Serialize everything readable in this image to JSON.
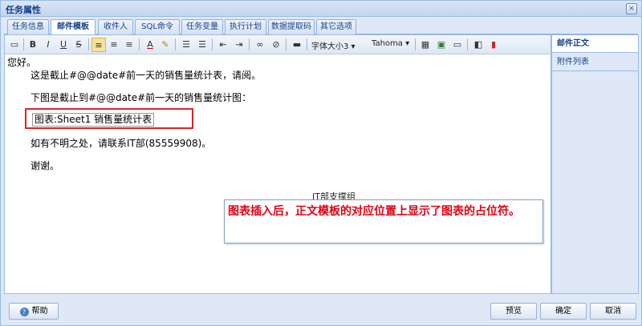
{
  "window": {
    "title": "任务属性",
    "close_glyph": "×"
  },
  "tabs": [
    {
      "label": "任务信息"
    },
    {
      "label": "邮件模板"
    },
    {
      "label": "收件人"
    },
    {
      "label": "SQL命令"
    },
    {
      "label": "任务变量"
    },
    {
      "label": "执行计划"
    },
    {
      "label": "数据提取码"
    },
    {
      "label": "其它选项"
    }
  ],
  "toolbar": {
    "bold": "B",
    "italic": "I",
    "underline": "U",
    "strike": "S",
    "font_color": "A",
    "font_size": "字体大小3",
    "font_name": "Tahoma",
    "icons": [
      "source-edit-icon",
      "bold-icon",
      "italic-icon",
      "underline-icon",
      "strikethrough-icon",
      "align-left-icon",
      "align-center-icon",
      "align-right-icon",
      "font-color-icon",
      "highlight-icon",
      "bullet-list-icon",
      "numbered-list-icon",
      "outdent-icon",
      "indent-icon",
      "link-icon",
      "unlink-icon",
      "horizontal-rule-icon",
      "table-icon",
      "insert-excel-icon",
      "insert-image-icon",
      "chart-icon",
      "bar-chart-icon"
    ]
  },
  "content": {
    "greeting": "您好。",
    "line1": "这是截止#@@date#前一天的销售量统计表，请阅。",
    "line2": "下图是截止到#@@date#前一天的销售量统计图：",
    "chart_placeholder": "图表:Sheet1 销售量统计表",
    "line3": "如有不明之处，请联系IT部(85559908)。",
    "thanks": "谢谢。",
    "signature": "IT部支撑组",
    "callout": "图表插入后，正文模板的对应位置上显示了图表的占位符。"
  },
  "right_panel": {
    "items": [
      {
        "label": "邮件正文"
      },
      {
        "label": "附件列表"
      }
    ]
  },
  "buttons": {
    "help": "帮助",
    "preview": "预览",
    "ok": "确定",
    "cancel": "取消"
  },
  "colors": {
    "title_text": "#15428b",
    "callout_text": "#e60012",
    "highlight_box": "#d9262a",
    "window_bg": "#dfe8f6"
  }
}
